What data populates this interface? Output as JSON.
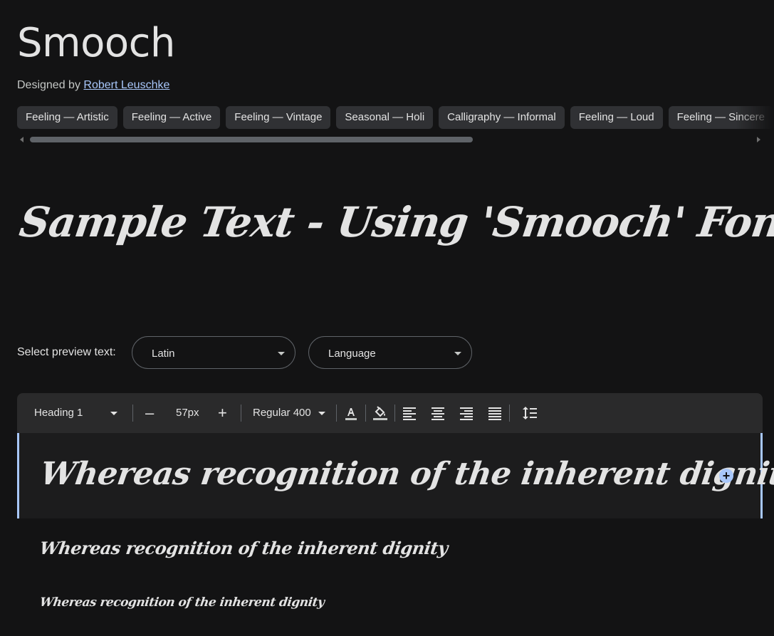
{
  "font": {
    "name": "Smooch",
    "designed_by_label": "Designed by",
    "designer": "Robert Leuschke"
  },
  "tags": [
    "Feeling — Artistic",
    "Feeling — Active",
    "Feeling — Vintage",
    "Seasonal — Holi",
    "Calligraphy — Informal",
    "Feeling — Loud",
    "Feeling — Sincere"
  ],
  "hero_sample": "Sample Text - Using 'Smooch' Font.",
  "preview_controls": {
    "label": "Select preview text:",
    "script_select": "Latin",
    "language_select": "Language"
  },
  "toolbar": {
    "style_select": "Heading 1",
    "decrease": "–",
    "size": "57px",
    "increase": "+",
    "weight_select": "Regular 400",
    "icons": [
      "text-color-icon",
      "highlight-color-icon",
      "align-left-icon",
      "align-center-icon",
      "align-right-icon",
      "align-justify-icon",
      "line-spacing-icon"
    ]
  },
  "samples": {
    "h1": "Whereas recognition of the inherent dignity",
    "h2": "Whereas recognition of the inherent dignity",
    "h3": "Whereas recognition of the inherent dignity"
  },
  "colors": {
    "background": "#131314",
    "accent": "#a8c7fa",
    "chip": "#303134",
    "toolbar": "#2a2a2b"
  }
}
